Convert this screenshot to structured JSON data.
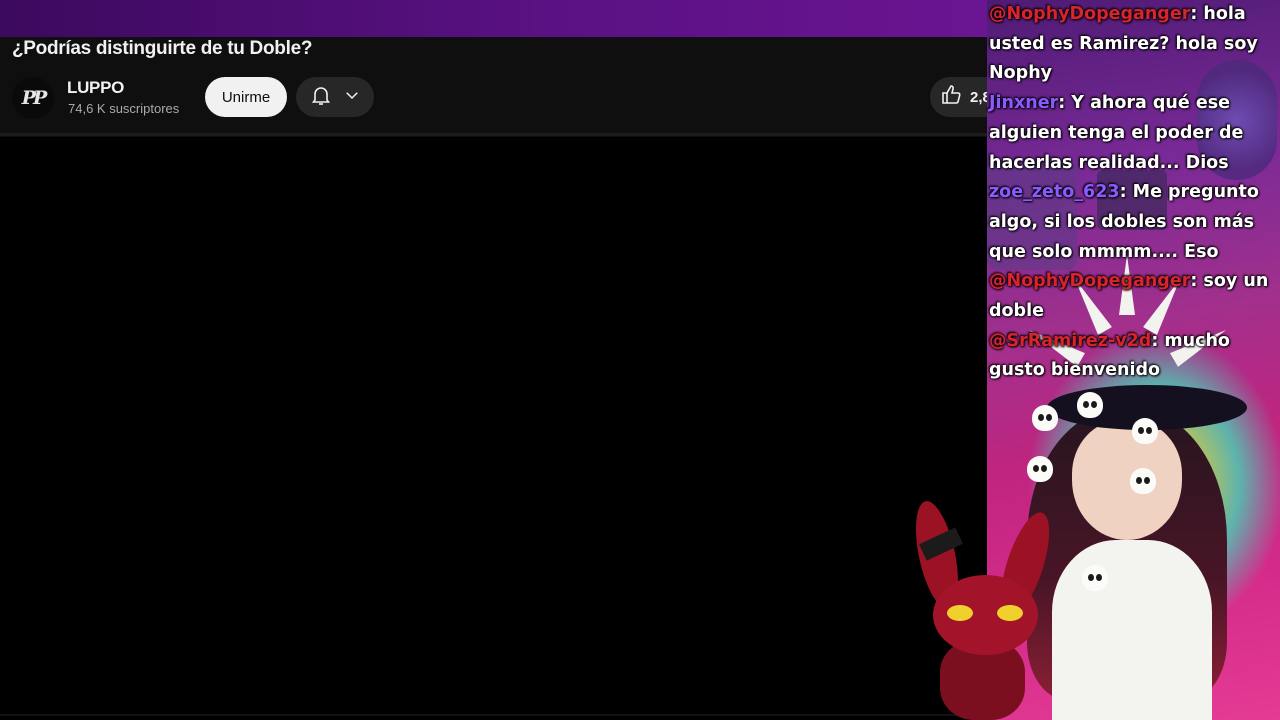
{
  "video": {
    "title": "¿Podrías distinguirte de tu Doble?",
    "like_count": "2,8"
  },
  "channel": {
    "avatar_text": "PP",
    "name": "LUPPO",
    "subscribers": "74,6 K suscriptores",
    "join_label": "Unirme"
  },
  "icons": {
    "bell": "bell-icon",
    "chevron": "chevron-down-icon",
    "like": "thumbs-up-icon"
  },
  "colors": {
    "page_bg": "#0f0f0f",
    "join_bg": "#f1f1f1",
    "overlay_purple": "#7a2a97",
    "overlay_pink": "#d42b8a"
  },
  "chat": [
    {
      "user": "@NophyDopeganger",
      "user_color": "#d8242c",
      "message": ": hola usted es Ramirez? hola soy Nophy"
    },
    {
      "user": "Jinxner",
      "user_color": "#8a5cff",
      "message": ": Y ahora qué ese alguien tenga el poder de hacerlas realidad... Dios"
    },
    {
      "user": "zoe_zeto_623",
      "user_color": "#8a5cff",
      "message": ": Me pregunto algo, si los dobles son más que solo mmmm.... Eso"
    },
    {
      "user": "@NophyDopeganger",
      "user_color": "#d8242c",
      "message": ": soy un doble"
    },
    {
      "user": "@SrRamirez-v2d",
      "user_color": "#d8242c",
      "message": ": mucho gusto bienvenido"
    }
  ]
}
